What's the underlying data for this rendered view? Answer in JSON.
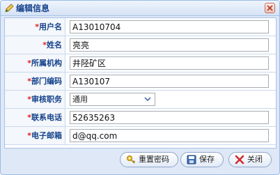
{
  "window": {
    "title": "编辑信息",
    "title_icon": "edit-pencil-icon",
    "close_icon": "close-icon"
  },
  "form": {
    "required_mark": "*",
    "fields": [
      {
        "label": "用户名",
        "value": "A13010704"
      },
      {
        "label": "姓名",
        "value": "亮亮"
      },
      {
        "label": "所属机构",
        "value": "井陉矿区"
      },
      {
        "label": "部门编码",
        "value": "A130107"
      },
      {
        "label": "审核职务",
        "value": "通用"
      },
      {
        "label": "联系电话",
        "value": "52635263"
      },
      {
        "label": "电子邮箱",
        "value": "d@qq.com"
      }
    ]
  },
  "buttons": {
    "reset_password": {
      "label": "重置密码",
      "icon": "key-icon"
    },
    "save": {
      "label": "保存",
      "icon": "save-icon"
    },
    "close": {
      "label": "关闭",
      "icon": "close-x-icon"
    }
  },
  "colors": {
    "title_text": "#15428b",
    "label_text": "#15428b",
    "required_star": "#e02020",
    "panel_border": "#99bbe8"
  }
}
